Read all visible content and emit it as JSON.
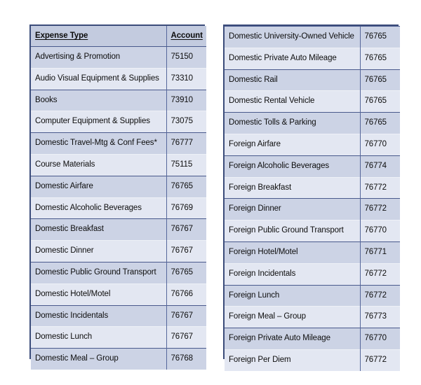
{
  "page": {
    "background": "#ffffff",
    "accent_border": "#3b4c7a",
    "row_dark": "#ccd3e5",
    "row_light": "#e3e7f2",
    "header_bg": "#c3cbdf"
  },
  "left_table": {
    "name": "expense-type-account-table-left",
    "headers": {
      "expense_type": "Expense Type",
      "account": "Account"
    },
    "rows": [
      {
        "expense_type": "Advertising & Promotion",
        "account": "75150"
      },
      {
        "expense_type": "Audio Visual Equipment & Supplies",
        "account": "73310"
      },
      {
        "expense_type": "Books",
        "account": "73910"
      },
      {
        "expense_type": "Computer Equipment & Supplies",
        "account": "73075"
      },
      {
        "expense_type": "Domestic Travel-Mtg & Conf Fees*",
        "account": "76777"
      },
      {
        "expense_type": "Course Materials",
        "account": "75115"
      },
      {
        "expense_type": "Domestic Airfare",
        "account": "76765"
      },
      {
        "expense_type": "Domestic Alcoholic Beverages",
        "account": "76769"
      },
      {
        "expense_type": "Domestic Breakfast",
        "account": "76767"
      },
      {
        "expense_type": "Domestic Dinner",
        "account": "76767"
      },
      {
        "expense_type": "Domestic Public Ground Transport",
        "account": "76765"
      },
      {
        "expense_type": "Domestic Hotel/Motel",
        "account": "76766"
      },
      {
        "expense_type": "Domestic Incidentals",
        "account": "76767"
      },
      {
        "expense_type": "Domestic Lunch",
        "account": "76767"
      },
      {
        "expense_type": "Domestic Meal – Group",
        "account": "76768"
      }
    ]
  },
  "right_table": {
    "name": "expense-type-account-table-right",
    "rows": [
      {
        "expense_type": "Domestic University-Owned Vehicle",
        "account": "76765"
      },
      {
        "expense_type": "Domestic Private Auto Mileage",
        "account": "76765"
      },
      {
        "expense_type": "Domestic Rail",
        "account": "76765"
      },
      {
        "expense_type": "Domestic Rental Vehicle",
        "account": "76765"
      },
      {
        "expense_type": "Domestic Tolls & Parking",
        "account": "76765"
      },
      {
        "expense_type": "Foreign Airfare",
        "account": "76770"
      },
      {
        "expense_type": "Foreign Alcoholic Beverages",
        "account": "76774"
      },
      {
        "expense_type": "Foreign Breakfast",
        "account": "76772"
      },
      {
        "expense_type": "Foreign Dinner",
        "account": "76772"
      },
      {
        "expense_type": "Foreign Public Ground Transport",
        "account": "76770"
      },
      {
        "expense_type": "Foreign Hotel/Motel",
        "account": "76771"
      },
      {
        "expense_type": "Foreign Incidentals",
        "account": "76772"
      },
      {
        "expense_type": "Foreign Lunch",
        "account": "76772"
      },
      {
        "expense_type": "Foreign Meal – Group",
        "account": "76773"
      },
      {
        "expense_type": "Foreign Private Auto Mileage",
        "account": "76770"
      },
      {
        "expense_type": "Foreign Per Diem",
        "account": "76772"
      }
    ]
  }
}
